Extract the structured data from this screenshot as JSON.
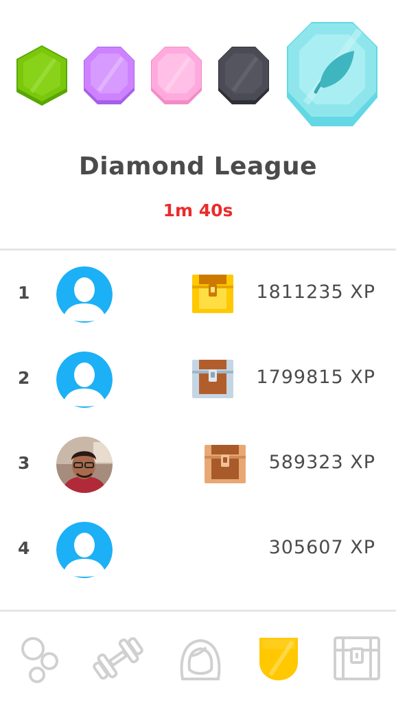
{
  "league": {
    "title": "Diamond League",
    "timer": "1m 40s",
    "badges": [
      {
        "name": "emerald",
        "color": "#7ac70c"
      },
      {
        "name": "amethyst",
        "color": "#ce82ff"
      },
      {
        "name": "pearl",
        "color": "#ffaade"
      },
      {
        "name": "obsidian",
        "color": "#4b4b4b"
      },
      {
        "name": "diamond",
        "color": "#8ee6ec",
        "current": true
      }
    ]
  },
  "leaderboard": [
    {
      "rank": "1",
      "xp": "1811235 XP",
      "avatar": "default",
      "chest": "gold"
    },
    {
      "rank": "2",
      "xp": "1799815 XP",
      "avatar": "default",
      "chest": "silver"
    },
    {
      "rank": "3",
      "xp": "589323 XP",
      "avatar": "photo",
      "chest": "bronze"
    },
    {
      "rank": "4",
      "xp": "305607 XP",
      "avatar": "default",
      "chest": "none"
    }
  ],
  "tabbar": {
    "tabs": [
      {
        "icon": "learn-icon",
        "active": false
      },
      {
        "icon": "practice-icon",
        "active": false
      },
      {
        "icon": "profile-icon",
        "active": false
      },
      {
        "icon": "leaderboard-icon",
        "active": true
      },
      {
        "icon": "shop-icon",
        "active": false
      }
    ]
  },
  "colors": {
    "accent_red": "#ea2b2b",
    "avatar_blue": "#1cb0f6",
    "gold": "#ffc800",
    "active_tab": "#ffc800",
    "inactive_tab": "#d0d0d0"
  }
}
